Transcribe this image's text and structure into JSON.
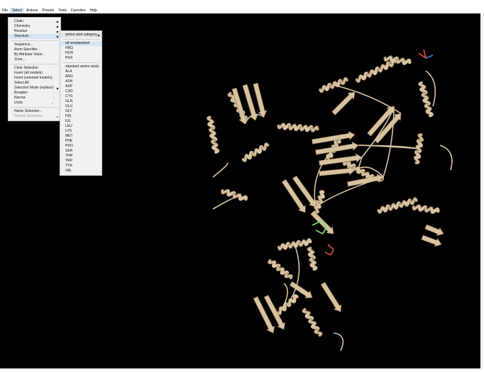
{
  "menubar": [
    "File",
    "Select",
    "Actions",
    "Presets",
    "Tools",
    "Favorites",
    "Help"
  ],
  "select_menu": {
    "groups": [
      [
        {
          "label": "Chain",
          "submenu": true
        },
        {
          "label": "Chemistry",
          "submenu": true
        },
        {
          "label": "Residue",
          "submenu": true
        },
        {
          "label": "Structure",
          "submenu": true,
          "highlighted": true
        }
      ],
      [
        {
          "label": "Sequence..."
        },
        {
          "label": "Atom Specifier..."
        },
        {
          "label": "By Attribute Value..."
        },
        {
          "label": "Zone..."
        }
      ],
      [
        {
          "label": "Clear Selection"
        },
        {
          "label": "Invert (all models)"
        },
        {
          "label": "Invert (selected models)",
          "shortcut": "→"
        },
        {
          "label": "Select All"
        },
        {
          "label": "Selection Mode (replace)",
          "submenu": true
        },
        {
          "label": "Broaden",
          "shortcut": "↑"
        },
        {
          "label": "Narrow",
          "shortcut": "↓"
        },
        {
          "label": "Undo",
          "shortcut": "←"
        }
      ],
      [
        {
          "label": "Name Selection..."
        },
        {
          "label": "Named Selections",
          "submenu": true,
          "disabled": true
        }
      ]
    ]
  },
  "structure_submenu": {
    "items": [
      {
        "label": "amino acid category",
        "submenu": true,
        "header": true
      },
      {
        "sep": true
      },
      {
        "label": "all nonstandard",
        "highlighted": true
      },
      {
        "label": "HBQ"
      },
      {
        "label": "HOH"
      },
      {
        "label": "PO4"
      },
      {
        "sep": true
      },
      {
        "label": "standard amino acids"
      },
      {
        "label": "ALA"
      },
      {
        "label": "ARG"
      },
      {
        "label": "ASN"
      },
      {
        "label": "ASP"
      },
      {
        "label": "CSD"
      },
      {
        "label": "CYS"
      },
      {
        "label": "GLN"
      },
      {
        "label": "GLU"
      },
      {
        "label": "GLY"
      },
      {
        "label": "HIS"
      },
      {
        "label": "ILE"
      },
      {
        "label": "LEU"
      },
      {
        "label": "LYS"
      },
      {
        "label": "MET"
      },
      {
        "label": "PHE"
      },
      {
        "label": "PRO"
      },
      {
        "label": "SER"
      },
      {
        "label": "THR"
      },
      {
        "label": "TRP"
      },
      {
        "label": "TYR"
      },
      {
        "label": "VAL"
      }
    ]
  },
  "icons": {
    "submenu": "triangle-right-icon"
  },
  "colors": {
    "viewport_bg": "#000000",
    "ribbon": "#d8c3a0",
    "ribbon_shadow": "#8a7758",
    "ligand_green": "#7bdc6c",
    "ligand_red": "#d24a3a",
    "ligand_blue": "#3a6fd2",
    "menu_bg": "#f1f1f1",
    "highlight": "#d6e4f3"
  }
}
